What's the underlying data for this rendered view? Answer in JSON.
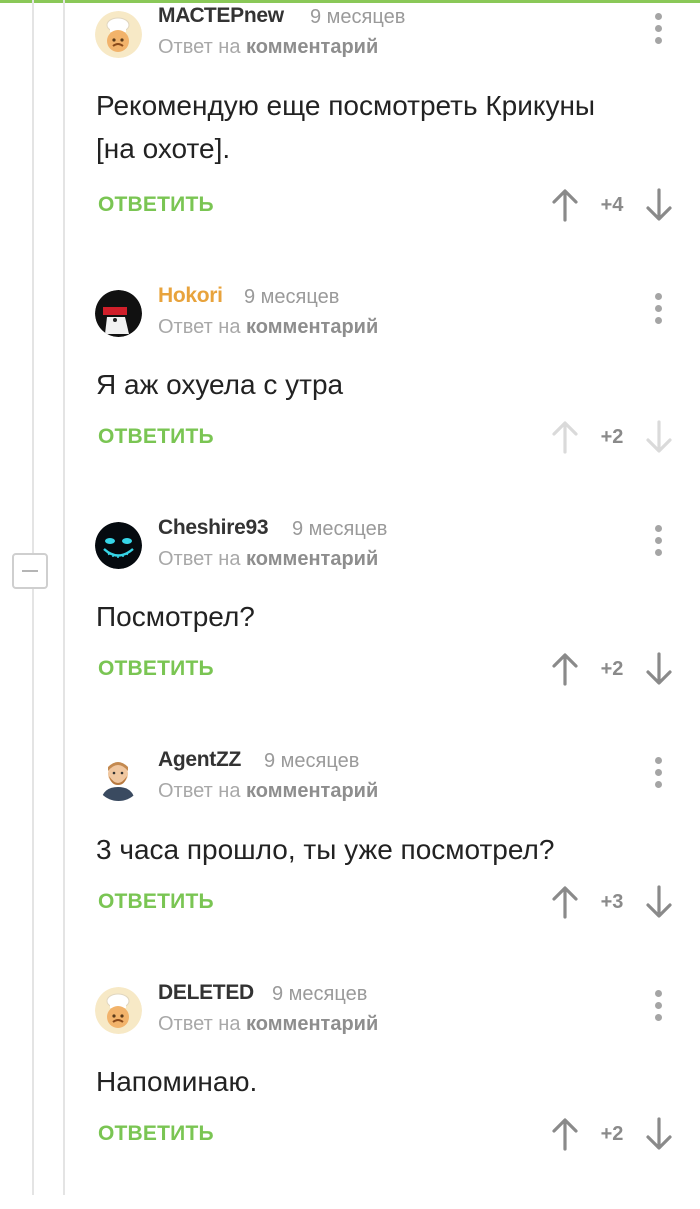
{
  "colors": {
    "accent_green": "#7ac553",
    "top_bar": "#8ac858",
    "author_highlight": "#e8a33c",
    "text": "#222222",
    "muted": "#9a9a9a"
  },
  "comments": [
    {
      "author": "МАСТЕРnew",
      "time": "9 месяцев",
      "reply_prefix": "Ответ на",
      "reply_target": "комментарий",
      "text_line1": "Рекомендую еще посмотреть Крикуны",
      "text_line2": "[на охоте].",
      "reply_label": "ОТВЕТИТЬ",
      "score": "+4",
      "avatar_icon": "chef-avatar-icon"
    },
    {
      "author": "Hokori",
      "time": "9 месяцев",
      "reply_prefix": "Ответ на",
      "reply_target": "комментарий",
      "text_line1": "Я аж охуела с утра",
      "reply_label": "ОТВЕТИТЬ",
      "score": "+2",
      "avatar_icon": "anime-avatar-icon"
    },
    {
      "author": "Cheshire93",
      "time": "9 месяцев",
      "reply_prefix": "Ответ на",
      "reply_target": "комментарий",
      "text_line1": "Посмотрел?",
      "reply_label": "ОТВЕТИТЬ",
      "score": "+2",
      "avatar_icon": "cheshire-cat-avatar-icon"
    },
    {
      "author": "AgentZZ",
      "time": "9 месяцев",
      "reply_prefix": "Ответ на",
      "reply_target": "комментарий",
      "text_line1": "3 часа прошло, ты уже посмотрел?",
      "reply_label": "ОТВЕТИТЬ",
      "score": "+3",
      "avatar_icon": "bearded-man-avatar-icon"
    },
    {
      "author": "DELETED",
      "time": "9 месяцев",
      "reply_prefix": "Ответ на",
      "reply_target": "комментарий",
      "text_line1": "Напоминаю.",
      "reply_label": "ОТВЕТИТЬ",
      "score": "+2",
      "avatar_icon": "chef-avatar-icon"
    }
  ]
}
